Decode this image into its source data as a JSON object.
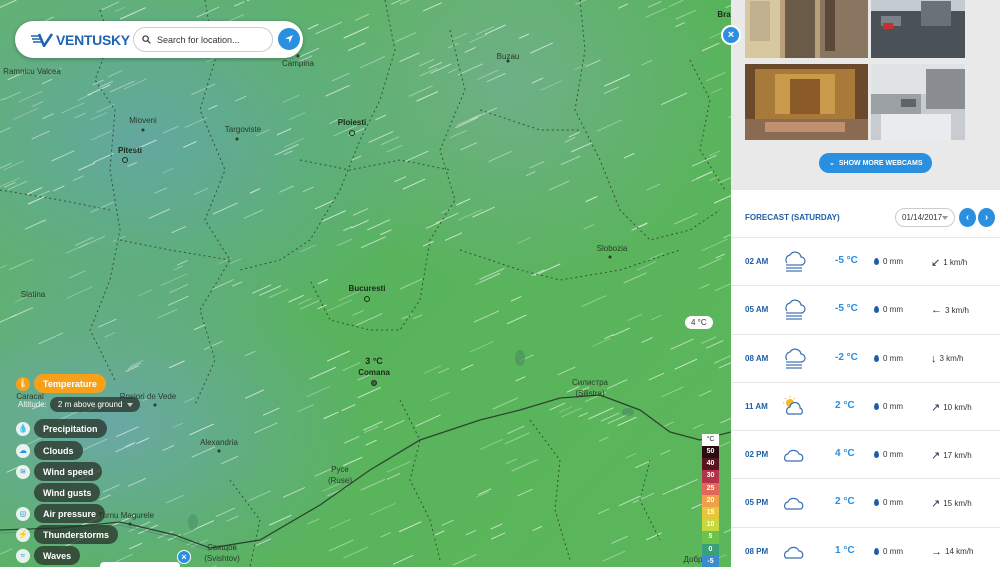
{
  "header": {
    "logo_text": "VENTUSKY",
    "search_placeholder": "Search for location..."
  },
  "map": {
    "cities": [
      {
        "name": "Ramnicu Valcea",
        "bold": false
      },
      {
        "name": "Campina",
        "bold": false
      },
      {
        "name": "Buzau",
        "bold": false
      },
      {
        "name": "Mioveni",
        "bold": false
      },
      {
        "name": "Targoviste",
        "bold": false
      },
      {
        "name": "Ploiesti",
        "bold": true
      },
      {
        "name": "Pitesti",
        "bold": true
      },
      {
        "name": "Slobozia",
        "bold": false
      },
      {
        "name": "Slatina",
        "bold": false
      },
      {
        "name": "Bucuresti",
        "bold": true
      },
      {
        "name": "Comana",
        "bold": true
      },
      {
        "name": "Caracal",
        "bold": false
      },
      {
        "name": "Rosiori de Vede",
        "bold": false
      },
      {
        "name": "Alexandria",
        "bold": false
      },
      {
        "name": "Силистра",
        "bold": false
      },
      {
        "name": "(Silistra)",
        "bold": false
      },
      {
        "name": "Русе",
        "bold": false
      },
      {
        "name": "(Ruse)",
        "bold": false
      },
      {
        "name": "Turnu Magurele",
        "bold": false
      },
      {
        "name": "Свищов",
        "bold": false
      },
      {
        "name": "(Svishtov)",
        "bold": false
      },
      {
        "name": "Bra",
        "bold": true
      },
      {
        "name": "Добр",
        "bold": false
      }
    ],
    "point_temp": "3 °C",
    "bubble_temp": "4 °C",
    "altitude_label": "Altitude:",
    "altitude_value": "2 m above ground",
    "layers": [
      {
        "label": "Temperature",
        "icon": "thermometer-icon",
        "active": true
      },
      {
        "label": "Precipitation",
        "icon": "raindrop-icon",
        "active": false
      },
      {
        "label": "Clouds",
        "icon": "cloud-icon",
        "active": false
      },
      {
        "label": "Wind speed",
        "icon": "wind-icon",
        "active": false
      },
      {
        "label": "Wind gusts",
        "icon": "",
        "active": false
      },
      {
        "label": "Air pressure",
        "icon": "pressure-icon",
        "active": false
      },
      {
        "label": "Thunderstorms",
        "icon": "lightning-icon",
        "active": false
      },
      {
        "label": "Waves",
        "icon": "waves-icon",
        "active": false
      }
    ],
    "legend": {
      "unit": "°C",
      "scale": [
        {
          "value": "50",
          "color": "#2a0c10"
        },
        {
          "value": "40",
          "color": "#5a1320"
        },
        {
          "value": "30",
          "color": "#b5334a"
        },
        {
          "value": "25",
          "color": "#e0675a"
        },
        {
          "value": "20",
          "color": "#f0a04a"
        },
        {
          "value": "15",
          "color": "#e8c63a"
        },
        {
          "value": "10",
          "color": "#c8d840"
        },
        {
          "value": "5",
          "color": "#6cc24a"
        },
        {
          "value": "0",
          "color": "#3aa07a"
        },
        {
          "value": "-5",
          "color": "#3a8cd0"
        }
      ]
    }
  },
  "panel": {
    "close": "×",
    "show_more_label": "SHOW MORE WEBCAMS",
    "forecast_title": "FORECAST (SATURDAY)",
    "date_value": "01/14/2017",
    "rows": [
      {
        "time": "02 AM",
        "icon": "fog-icon",
        "temp": "-5 °C",
        "precip": "0 mm",
        "wind_dir": "↙",
        "wind": "1 km/h"
      },
      {
        "time": "05 AM",
        "icon": "fog-icon",
        "temp": "-5 °C",
        "precip": "0 mm",
        "wind_dir": "←",
        "wind": "3 km/h"
      },
      {
        "time": "08 AM",
        "icon": "fog-icon",
        "temp": "-2 °C",
        "precip": "0 mm",
        "wind_dir": "↓",
        "wind": "3 km/h"
      },
      {
        "time": "11 AM",
        "icon": "partly-sunny-icon",
        "temp": "2 °C",
        "precip": "0 mm",
        "wind_dir": "↗",
        "wind": "10 km/h"
      },
      {
        "time": "02 PM",
        "icon": "cloud-icon",
        "temp": "4 °C",
        "precip": "0 mm",
        "wind_dir": "↗",
        "wind": "17 km/h"
      },
      {
        "time": "05 PM",
        "icon": "cloud-icon",
        "temp": "2 °C",
        "precip": "0 mm",
        "wind_dir": "↗",
        "wind": "15 km/h"
      },
      {
        "time": "08 PM",
        "icon": "cloud-icon",
        "temp": "1 °C",
        "precip": "0 mm",
        "wind_dir": "→",
        "wind": "14 km/h"
      }
    ]
  }
}
